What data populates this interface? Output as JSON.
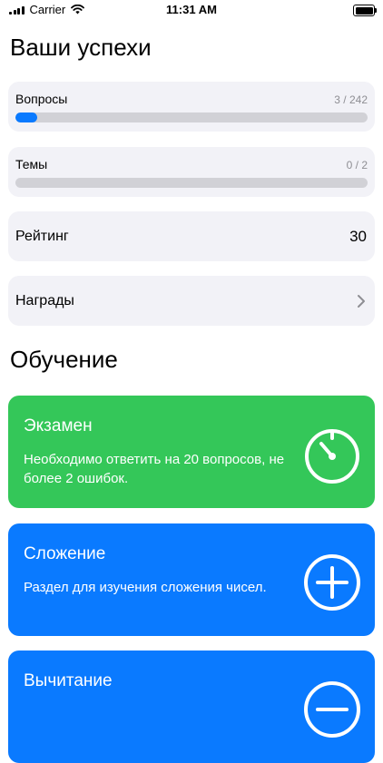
{
  "status_bar": {
    "carrier": "Carrier",
    "time": "11:31 AM"
  },
  "achievements": {
    "title": "Ваши успехи",
    "questions": {
      "label": "Вопросы",
      "count": "3 / 242",
      "progress": 0.0124
    },
    "topics": {
      "label": "Темы",
      "count": "0 / 2",
      "progress": 0
    },
    "rating": {
      "label": "Рейтинг",
      "value": "30"
    },
    "awards": {
      "label": "Награды"
    }
  },
  "learning": {
    "title": "Обучение",
    "cards": [
      {
        "title": "Экзамен",
        "description": "Необходимо ответить на 20 вопросов, не более 2 ошибок.",
        "icon": "stopwatch-icon",
        "color": "#34c759"
      },
      {
        "title": "Сложение",
        "description": "Раздел для изучения сложения чисел.",
        "icon": "plus-circle-icon",
        "color": "#0a7aff"
      },
      {
        "title": "Вычитание",
        "description": "",
        "icon": "minus-circle-icon",
        "color": "#0a7aff"
      }
    ]
  }
}
